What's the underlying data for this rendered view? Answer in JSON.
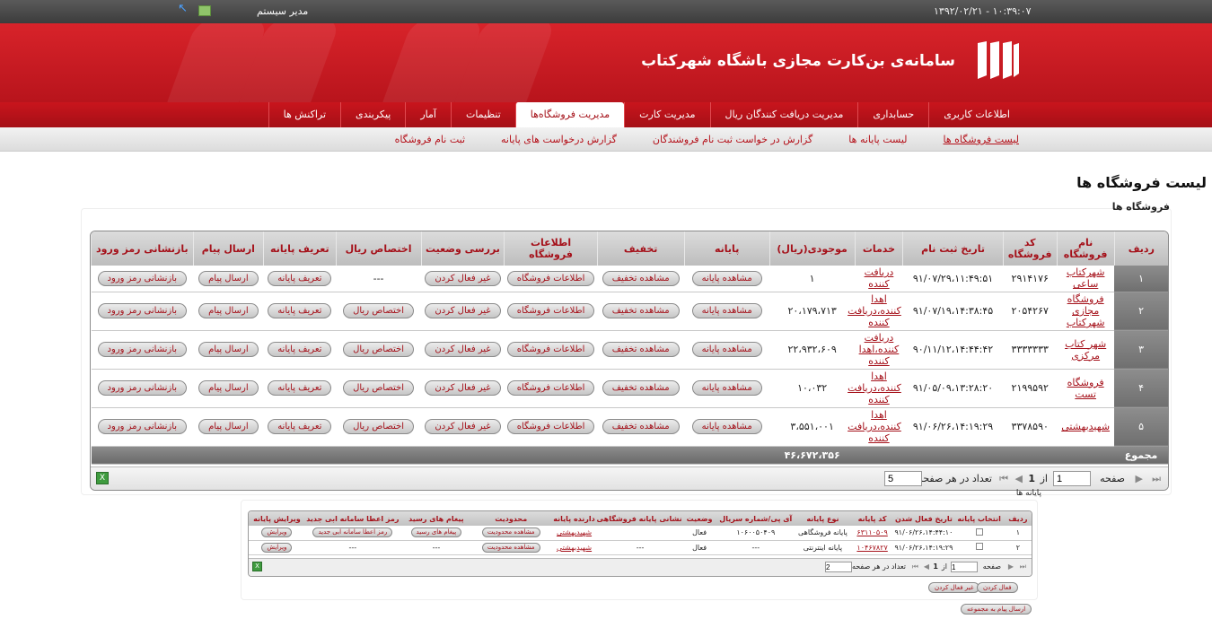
{
  "topbar": {
    "clock": "۱۳۹۲/۰۲/۲۱ - ۱۰:۳۹:۰۷",
    "admin": "مدیر سیستم"
  },
  "header": {
    "title": "سامانه‌ی بن‌کارت مجازی باشگاه شهرکتاب"
  },
  "mainnav": [
    "اطلاعات کاربری",
    "حسابداری",
    "مدیریت دریافت کنندگان ریال",
    "مدیریت کارت",
    "مدیریت فروشگاه‌ها",
    "تنظیمات",
    "آمار",
    "پیکربندی",
    "تراکنش ها"
  ],
  "subnav": [
    "لیست فروشگاه ها",
    "لیست پایانه ها",
    "گزارش در خواست ثبت نام فروشندگان",
    "گزارش درخواست های پایانه",
    "ثبت نام فروشگاه"
  ],
  "page_title": "لیست فروشگاه ها",
  "section_title": "فروشگاه ها",
  "stores": {
    "headers": [
      "ردیف",
      "نام فروشگاه",
      "کد فروشگاه",
      "تاریخ ثبت نام",
      "خدمات",
      "موجودی(ریال)",
      "پایانه",
      "تخفیف",
      "اطلاعات فروشگاه",
      "بررسی وضعیت",
      "اختصاص ریال",
      "تعریف پایانه",
      "ارسال پیام",
      "بازنشانی رمز ورود"
    ],
    "btn_terminal": "مشاهده پایانه",
    "btn_discount": "مشاهده تخفیف",
    "btn_info": "اطلاعات فروشگاه",
    "btn_deactivate": "غیر فعال کردن",
    "btn_allocate": "اختصاص ریال",
    "btn_define": "تعریف پایانه",
    "btn_message": "ارسال پیام",
    "btn_reset": "بازنشانی رمز ورود",
    "rows": [
      {
        "no": "۱",
        "name": "شهرکتاب ساعی",
        "code": "۲۹۱۴۱۷۶",
        "date": "۹۱/۰۷/۲۹،۱۱:۴۹:۵۱",
        "service": "دریافت کننده",
        "balance": "۱",
        "allocate": "---"
      },
      {
        "no": "۲",
        "name": "فروشگاه مجازی شهرکتاب",
        "code": "۲۰۵۴۲۶۷",
        "date": "۹۱/۰۷/۱۹،۱۴:۳۸:۴۵",
        "service": "اهدا کننده،دریافت کننده",
        "balance": "۲۰،۱۷۹،۷۱۳",
        "allocate": ""
      },
      {
        "no": "۳",
        "name": "شهر کتاب مرکزی",
        "code": "۳۳۳۳۳۳۳",
        "date": "۹۰/۱۱/۱۲،۱۴:۴۴:۴۲",
        "service": "دریافت کننده،اهدا کننده",
        "balance": "۲۲،۹۳۲،۶۰۹",
        "allocate": ""
      },
      {
        "no": "۴",
        "name": "فروشگاه تست",
        "code": "۲۱۹۹۵۹۲",
        "date": "۹۱/۰۵/۰۹،۱۳:۲۸:۲۰",
        "service": "اهدا کننده،دریافت کننده",
        "balance": "۱۰،۰۳۲",
        "allocate": ""
      },
      {
        "no": "۵",
        "name": "شهیدبهشتی",
        "code": "۳۳۷۸۵۹۰",
        "date": "۹۱/۰۶/۲۶،۱۴:۱۹:۲۹",
        "service": "اهدا کننده،دریافت کننده",
        "balance": "۳،۵۵۱،۰۰۱",
        "allocate": ""
      }
    ],
    "total_label": "مجموع",
    "total_value": "۴۶،۶۷۲،۳۵۶",
    "pager": {
      "page_label": "صفحه",
      "page_value": "1",
      "of_label": "از",
      "of_value": "1",
      "page_size_label": "تعداد در هر صفحه:",
      "page_size_value": "5"
    }
  },
  "terminals": {
    "title": "پایانه ها",
    "headers": [
      "ردیف",
      "انتخاب پایانه",
      "تاریخ فعال شدن",
      "کد پایانه",
      "نوع پایانه",
      "آی پی/شماره سریال",
      "وضعیت",
      "نشانی پایانه فروشگاهی",
      "دارنده پایانه",
      "محدودیت",
      "پیغام های رسید",
      "رمز اعطا سامانه ابی جدید",
      "ویرایش پایانه"
    ],
    "rows": [
      {
        "no": "۱",
        "date": "۹۱/۰۶/۲۶،۱۴:۴۴:۱۰",
        "code": "۶۳۱۱۰۵۰۹",
        "type": "پایانه فروشگاهی",
        "ip": "۱۰۶۰۰۵۰۴۰۹",
        "status": "فعال",
        "address": "",
        "owner": "شهیدبهشتی",
        "limit": "مشاهده محدودیت",
        "receipt": "پیغام های رسید",
        "pwd": "رمز اعطا سامانه ابی جدید",
        "edit": "ویرایش"
      },
      {
        "no": "۲",
        "date": "۹۱/۰۶/۲۶،۱۴:۱۹:۲۹",
        "code": "۱۰۴۶۷۸۲۷",
        "type": "پایانه اینترنتی",
        "ip": "---",
        "status": "فعال",
        "address": "---",
        "owner": "شهیدبهشتی",
        "limit": "مشاهده محدودیت",
        "receipt": "---",
        "pwd": "---",
        "edit": "ویرایش"
      }
    ],
    "pager": {
      "page_label": "صفحه",
      "page_value": "1",
      "of_label": "از",
      "of_value": "1",
      "page_size_label": "تعداد در هر صفحه:",
      "page_size_value": "2"
    },
    "btn_deactivate": "غیر فعال کردن",
    "btn_activate": "فعال کردن",
    "btn_group_message": "ارسال پیام به مجموعه"
  }
}
